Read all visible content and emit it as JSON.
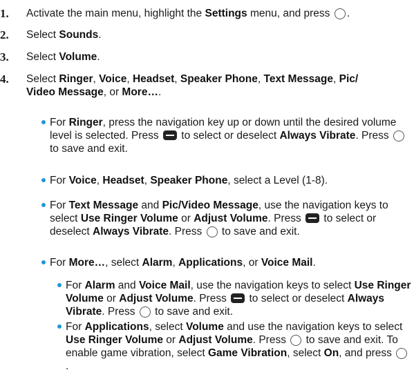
{
  "steps": [
    {
      "num": "1.",
      "parts": [
        {
          "t": "Activate the main menu, highlight the "
        },
        {
          "b": "Settings"
        },
        {
          "t": " menu, and press "
        },
        {
          "icon": "ok"
        },
        {
          "t": "."
        }
      ]
    },
    {
      "num": "2.",
      "parts": [
        {
          "t": "Select "
        },
        {
          "b": "Sounds"
        },
        {
          "t": "."
        }
      ]
    },
    {
      "num": "3.",
      "parts": [
        {
          "t": "Select "
        },
        {
          "b": "Volume"
        },
        {
          "t": "."
        }
      ]
    },
    {
      "num": "4.",
      "parts": [
        {
          "t": "Select "
        },
        {
          "b": "Ringer"
        },
        {
          "t": ", "
        },
        {
          "b": "Voice"
        },
        {
          "t": ", "
        },
        {
          "b": "Headset"
        },
        {
          "t": ", "
        },
        {
          "b": "Speaker Phone"
        },
        {
          "t": ", "
        },
        {
          "b": "Text Message"
        },
        {
          "t": ", "
        },
        {
          "b": "Pic/"
        },
        {
          "br": true
        },
        {
          "b": "Video Message"
        },
        {
          "t": ", or "
        },
        {
          "b": "More…"
        },
        {
          "t": "."
        }
      ]
    }
  ],
  "bullets": [
    {
      "parts": [
        {
          "t": "For "
        },
        {
          "b": "Ringer"
        },
        {
          "t": ", press the navigation key up or down until the desired volume level is selected. Press "
        },
        {
          "icon": "menu"
        },
        {
          "t": " to select or deselect "
        },
        {
          "b": "Always Vibrate"
        },
        {
          "t": ". Press "
        },
        {
          "icon": "ok"
        },
        {
          "t": " to save and exit."
        }
      ]
    },
    {
      "parts": [
        {
          "t": "For "
        },
        {
          "b": "Voice"
        },
        {
          "t": ", "
        },
        {
          "b": "Headset"
        },
        {
          "t": ", "
        },
        {
          "b": "Speaker Phone"
        },
        {
          "t": ", select a Level (1-8)."
        }
      ]
    },
    {
      "parts": [
        {
          "t": "For "
        },
        {
          "b": "Text Message"
        },
        {
          "t": " and "
        },
        {
          "b": "Pic/Video Message"
        },
        {
          "t": ", use the navigation keys to select "
        },
        {
          "b": "Use Ringer Volume"
        },
        {
          "t": " or "
        },
        {
          "b": "Adjust Volume"
        },
        {
          "t": ". Press "
        },
        {
          "icon": "menu"
        },
        {
          "t": " to select or deselect "
        },
        {
          "b": "Always Vibrate"
        },
        {
          "t": ". Press "
        },
        {
          "icon": "ok"
        },
        {
          "t": " to save and exit."
        }
      ]
    },
    {
      "parts": [
        {
          "t": "For "
        },
        {
          "b": "More…"
        },
        {
          "t": ", select "
        },
        {
          "b": "Alarm"
        },
        {
          "t": ", "
        },
        {
          "b": "Applications"
        },
        {
          "t": ", or "
        },
        {
          "b": "Voice Mail"
        },
        {
          "t": "."
        }
      ]
    }
  ],
  "subbullets": [
    {
      "parts": [
        {
          "t": "For "
        },
        {
          "b": "Alarm"
        },
        {
          "t": " and "
        },
        {
          "b": "Voice Mail"
        },
        {
          "t": ", use the navigation keys to select "
        },
        {
          "b": "Use Ringer Volume"
        },
        {
          "t": " or "
        },
        {
          "b": "Adjust Volume"
        },
        {
          "t": ". Press "
        },
        {
          "icon": "menu"
        },
        {
          "t": " to select or deselect "
        },
        {
          "b": "Always Vibrate"
        },
        {
          "t": ". Press "
        },
        {
          "icon": "ok"
        },
        {
          "t": " to save and exit."
        }
      ]
    },
    {
      "parts": [
        {
          "t": "For "
        },
        {
          "b": "Applications"
        },
        {
          "t": ", select "
        },
        {
          "b": "Volume"
        },
        {
          "t": " and use the navigation keys to select "
        },
        {
          "b": "Use Ringer Volume"
        },
        {
          "t": " or "
        },
        {
          "b": "Adjust Volume"
        },
        {
          "t": ". Press "
        },
        {
          "icon": "ok"
        },
        {
          "t": " to save and exit. To enable game vibration, select "
        },
        {
          "b": "Game Vibration"
        },
        {
          "t": ", select "
        },
        {
          "b": "On"
        },
        {
          "t": ", and press "
        },
        {
          "icon": "ok"
        },
        {
          "t": "."
        }
      ]
    }
  ],
  "icons": {
    "ok": "ok-key-circle-icon",
    "menu": "menu-softkey-icon"
  },
  "colors": {
    "bullet": "#1f98d6",
    "text": "#1a1a1a"
  }
}
